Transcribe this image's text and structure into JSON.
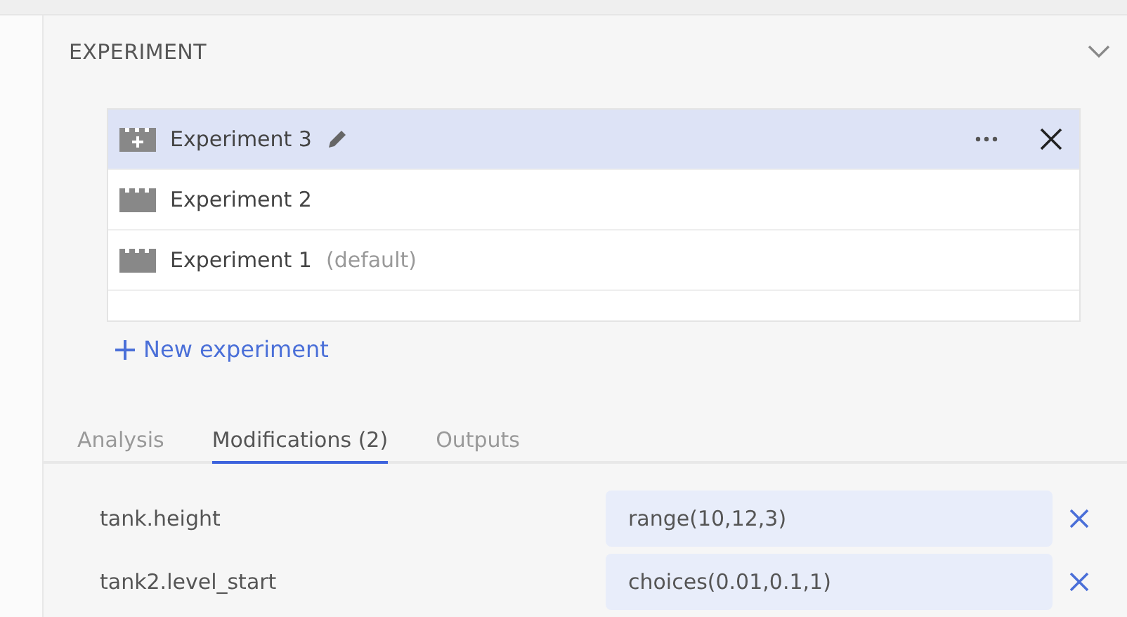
{
  "section": {
    "title": "EXPERIMENT",
    "expanded": true
  },
  "experiments": [
    {
      "name": "Experiment 3",
      "selected": true
    },
    {
      "name": "Experiment 2",
      "selected": false
    },
    {
      "name": "Experiment 1",
      "suffix": "(default)",
      "selected": false
    }
  ],
  "new_experiment": "New experiment",
  "tabs": [
    {
      "label": "Analysis",
      "selected": false
    },
    {
      "label": "Modifications (2)",
      "selected": true
    },
    {
      "label": "Outputs",
      "selected": false
    }
  ],
  "modifications": [
    {
      "name": "tank.height",
      "value": "range(10,12,3)"
    },
    {
      "name": "tank2.level_start",
      "value": "choices(0.01,0.1,1)"
    }
  ]
}
